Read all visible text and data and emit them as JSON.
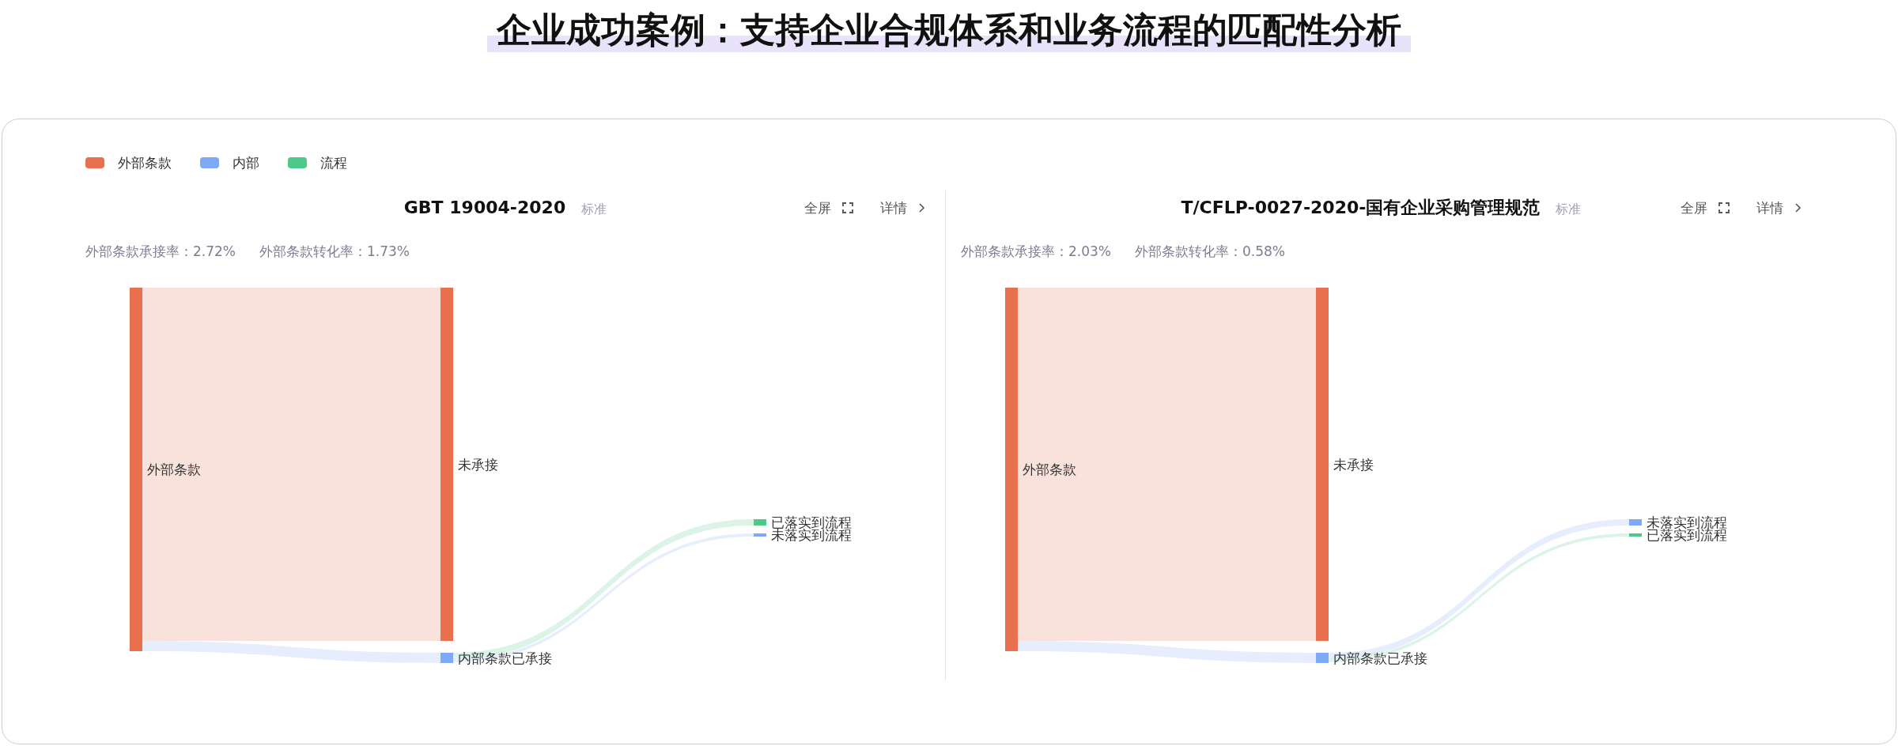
{
  "page_title": "企业成功案例：支持企业合规体系和业务流程的匹配性分析",
  "legend": [
    {
      "label": "外部条款",
      "color": "#e8704f"
    },
    {
      "label": "内部",
      "color": "#80a8f8"
    },
    {
      "label": "流程",
      "color": "#4fc98a"
    }
  ],
  "panels": [
    {
      "title": "GBT 19004-2020",
      "tag": "标准",
      "fullscreen_label": "全屏",
      "detail_label": "详情",
      "stats": [
        {
          "label": "外部条款承接率：",
          "value": "2.72%"
        },
        {
          "label": "外部条款转化率：",
          "value": "1.73%"
        }
      ],
      "nodes": [
        {
          "label": "外部条款",
          "kind": "source",
          "color": "#e8704f"
        },
        {
          "label": "未承接",
          "kind": "unaccepted",
          "color": "#e8704f"
        },
        {
          "label": "内部条款已承接",
          "kind": "accepted",
          "color": "#80a8f8"
        },
        {
          "label": "已落实到流程",
          "kind": "flow",
          "color": "#4fc98a"
        },
        {
          "label": "未落实到流程",
          "kind": "flow",
          "color": "#80a8f8"
        }
      ]
    },
    {
      "title": "T/CFLP-0027-2020-国有企业采购管理规范",
      "tag": "标准",
      "fullscreen_label": "全屏",
      "detail_label": "详情",
      "stats": [
        {
          "label": "外部条款承接率：",
          "value": "2.03%"
        },
        {
          "label": "外部条款转化率：",
          "value": "0.58%"
        }
      ],
      "nodes": [
        {
          "label": "外部条款",
          "kind": "source",
          "color": "#e8704f"
        },
        {
          "label": "未承接",
          "kind": "unaccepted",
          "color": "#e8704f"
        },
        {
          "label": "内部条款已承接",
          "kind": "accepted",
          "color": "#80a8f8"
        },
        {
          "label": "未落实到流程",
          "kind": "flow",
          "color": "#80a8f8"
        },
        {
          "label": "已落实到流程",
          "kind": "flow",
          "color": "#4fc98a"
        }
      ]
    }
  ]
}
